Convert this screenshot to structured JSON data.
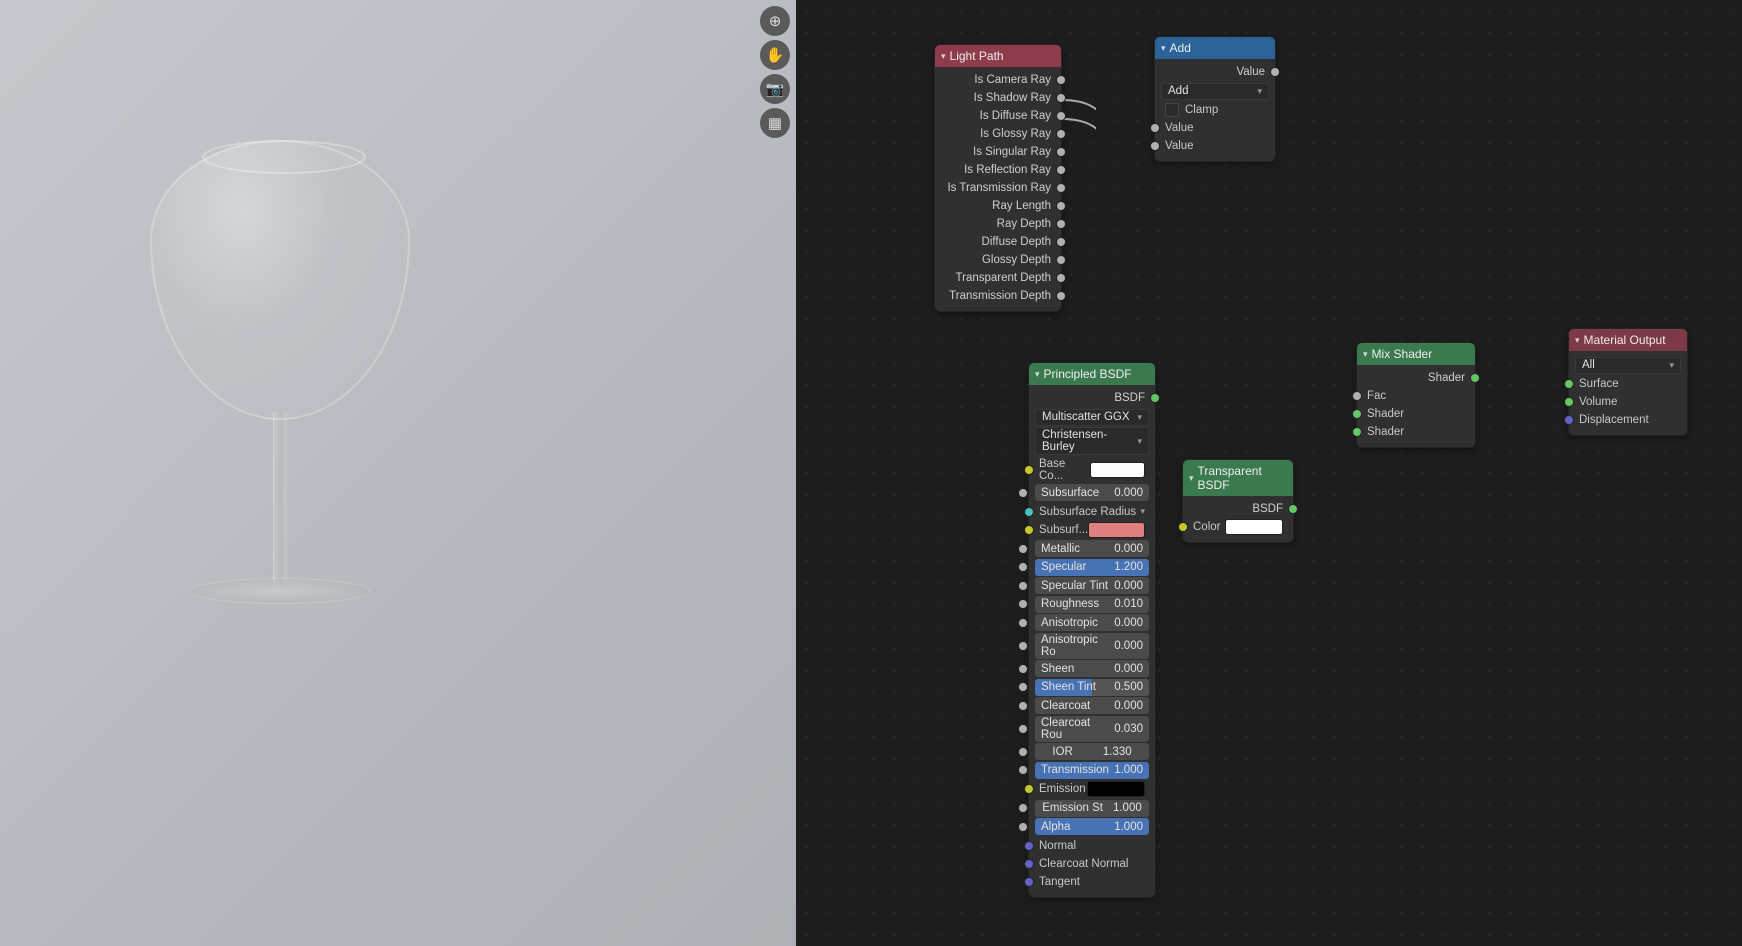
{
  "viewport_buttons": {
    "zoom": "magnify-plus-icon",
    "pan": "hand-icon",
    "camera": "camera-icon",
    "grid": "grid-icon"
  },
  "nodes": {
    "light_path": {
      "title": "Light Path",
      "outputs": [
        "Is Camera Ray",
        "Is Shadow Ray",
        "Is Diffuse Ray",
        "Is Glossy Ray",
        "Is Singular Ray",
        "Is Reflection Ray",
        "Is Transmission Ray",
        "Ray Length",
        "Ray Depth",
        "Diffuse Depth",
        "Glossy Depth",
        "Transparent Depth",
        "Transmission Depth"
      ]
    },
    "add": {
      "title": "Add",
      "out_value": "Value",
      "operation": "Add",
      "clamp": "Clamp",
      "in_value1": "Value",
      "in_value2": "Value"
    },
    "principled": {
      "title": "Principled BSDF",
      "out_bsdf": "BSDF",
      "distribution": "Multiscatter GGX",
      "subsurface_method": "Christensen-Burley",
      "base_color_label": "Base Co...",
      "subsurface_radius_label": "Subsurface Radius",
      "subsurf_color_label": "Subsurf...",
      "props": [
        {
          "name": "Subsurface",
          "value": "0.000",
          "blue": false
        },
        {
          "name": "Metallic",
          "value": "0.000",
          "blue": false
        },
        {
          "name": "Specular",
          "value": "1.200",
          "blue": true
        },
        {
          "name": "Specular Tint",
          "value": "0.000",
          "blue": false
        },
        {
          "name": "Roughness",
          "value": "0.010",
          "blue": false
        },
        {
          "name": "Anisotropic",
          "value": "0.000",
          "blue": false
        },
        {
          "name": "Anisotropic Ro",
          "value": "0.000",
          "blue": false
        },
        {
          "name": "Sheen",
          "value": "0.000",
          "blue": false
        },
        {
          "name": "Sheen Tint",
          "value": "0.500",
          "blue": true,
          "pct": 50
        },
        {
          "name": "Clearcoat",
          "value": "0.000",
          "blue": false
        },
        {
          "name": "Clearcoat Rou",
          "value": "0.030",
          "blue": false
        },
        {
          "name": "IOR",
          "value": "1.330",
          "blue": false
        },
        {
          "name": "Transmission",
          "value": "1.000",
          "blue": true
        },
        {
          "name": "Emission St",
          "value": "1.000",
          "blue": false
        },
        {
          "name": "Alpha",
          "value": "1.000",
          "blue": true
        }
      ],
      "emission_label": "Emission",
      "normal": "Normal",
      "clearcoat_normal": "Clearcoat Normal",
      "tangent": "Tangent"
    },
    "transparent": {
      "title": "Transparent BSDF",
      "out_bsdf": "BSDF",
      "color_label": "Color"
    },
    "mix_shader": {
      "title": "Mix Shader",
      "out_shader": "Shader",
      "fac": "Fac",
      "shader1": "Shader",
      "shader2": "Shader"
    },
    "material_output": {
      "title": "Material Output",
      "target": "All",
      "surface": "Surface",
      "volume": "Volume",
      "displacement": "Displacement"
    }
  }
}
